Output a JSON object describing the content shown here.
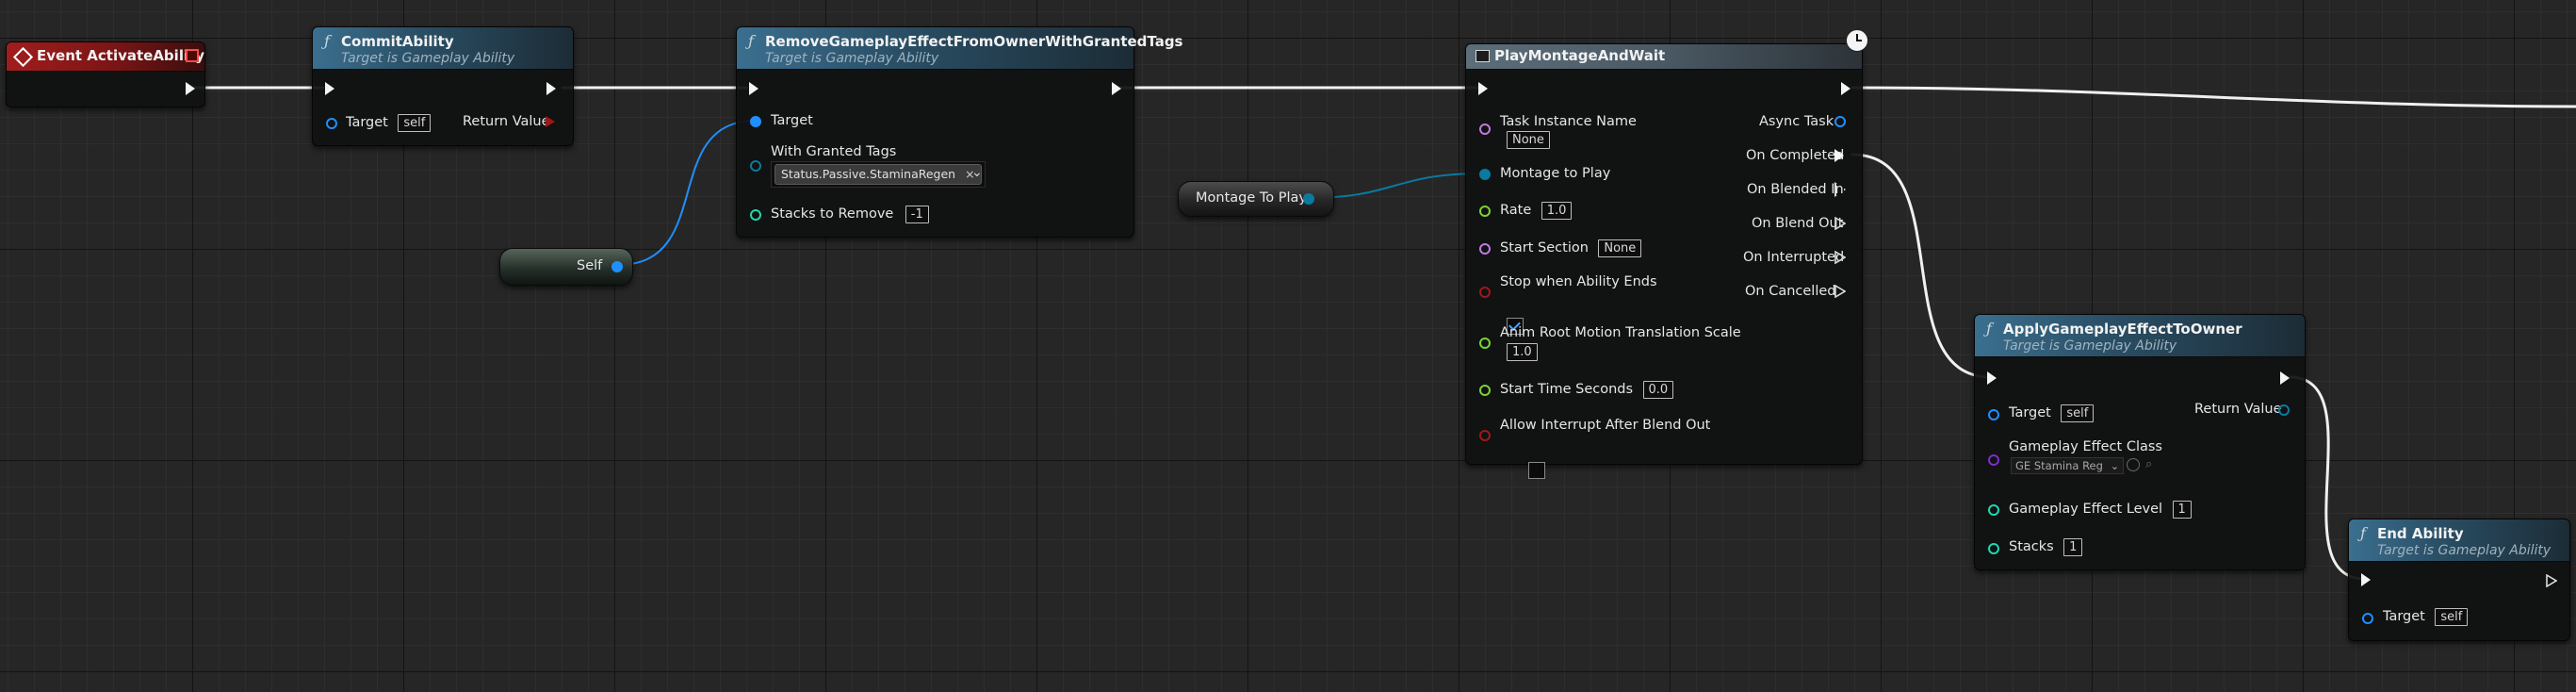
{
  "colors": {
    "exec": "#ffffff",
    "object": "#1f8fff",
    "struct": "#0b7aa0",
    "integer": "#1fd8b0",
    "float": "#7ad332",
    "name": "#c07ae0",
    "bool": "#a01818",
    "class": "#7b2fc7"
  },
  "nodes": {
    "event_activate": {
      "title": "Event ActivateAbility"
    },
    "commit_ability": {
      "title": "CommitAbility",
      "subtitle": "Target is Gameplay Ability",
      "target_label": "Target",
      "target_value": "self",
      "return_label": "Return Value"
    },
    "remove_effect": {
      "title": "RemoveGameplayEffectFromOwnerWithGrantedTags",
      "subtitle": "Target is Gameplay Ability",
      "target_label": "Target",
      "granted_tags_label": "With Granted Tags",
      "tag_value": "Status.Passive.StaminaRegen",
      "stacks_label": "Stacks to Remove",
      "stacks_value": "-1"
    },
    "self_node": {
      "label": "Self"
    },
    "montage_var": {
      "label": "Montage To Play"
    },
    "play_montage": {
      "title": "PlayMontageAndWait",
      "task_instance_label": "Task Instance Name",
      "task_instance_value": "None",
      "montage_label": "Montage to Play",
      "rate_label": "Rate",
      "rate_value": "1.0",
      "start_section_label": "Start Section",
      "start_section_value": "None",
      "stop_when_ends_label": "Stop when Ability Ends",
      "root_motion_label": "Anim Root Motion Translation Scale",
      "root_motion_value": "1.0",
      "start_time_label": "Start Time Seconds",
      "start_time_value": "0.0",
      "allow_interrupt_label": "Allow Interrupt After Blend Out",
      "async_task_label": "Async Task",
      "on_completed_label": "On Completed",
      "on_blended_in_label": "On Blended In",
      "on_blend_out_label": "On Blend Out",
      "on_interrupted_label": "On Interrupted",
      "on_cancelled_label": "On Cancelled"
    },
    "apply_effect": {
      "title": "ApplyGameplayEffectToOwner",
      "subtitle": "Target is Gameplay Ability",
      "target_label": "Target",
      "target_value": "self",
      "return_label": "Return Value",
      "effect_class_label": "Gameplay Effect Class",
      "effect_class_value": "GE Stamina Reg",
      "level_label": "Gameplay Effect Level",
      "level_value": "1",
      "stacks_label": "Stacks",
      "stacks_value": "1"
    },
    "end_ability": {
      "title": "End Ability",
      "subtitle": "Target is Gameplay Ability",
      "target_label": "Target",
      "target_value": "self"
    }
  }
}
